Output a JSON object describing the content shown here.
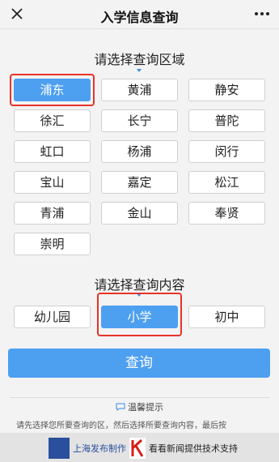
{
  "header": {
    "title": "入学信息查询",
    "close_icon": "close-icon",
    "more_icon": "more-dots-icon"
  },
  "district_section": {
    "title": "请选择查询区域"
  },
  "districts": [
    "浦东",
    "黄浦",
    "静安",
    "徐汇",
    "长宁",
    "普陀",
    "虹口",
    "杨浦",
    "闵行",
    "宝山",
    "嘉定",
    "松江",
    "青浦",
    "金山",
    "奉贤",
    "崇明"
  ],
  "selected_district": "浦东",
  "content_section": {
    "title": "请选择查询内容"
  },
  "contents": [
    "幼儿园",
    "小学",
    "初中"
  ],
  "selected_content": "小学",
  "query_button": "查询",
  "tips": {
    "title": "温馨提示",
    "body": "请先选择您所要查询的区，然后选择所要查询内容，最后按"
  },
  "footer": {
    "left_text": "上海发布制作",
    "right_text": "看看新闻提供技术支持"
  },
  "colors": {
    "accent": "#4d9ff0",
    "highlight": "#e8332a"
  }
}
